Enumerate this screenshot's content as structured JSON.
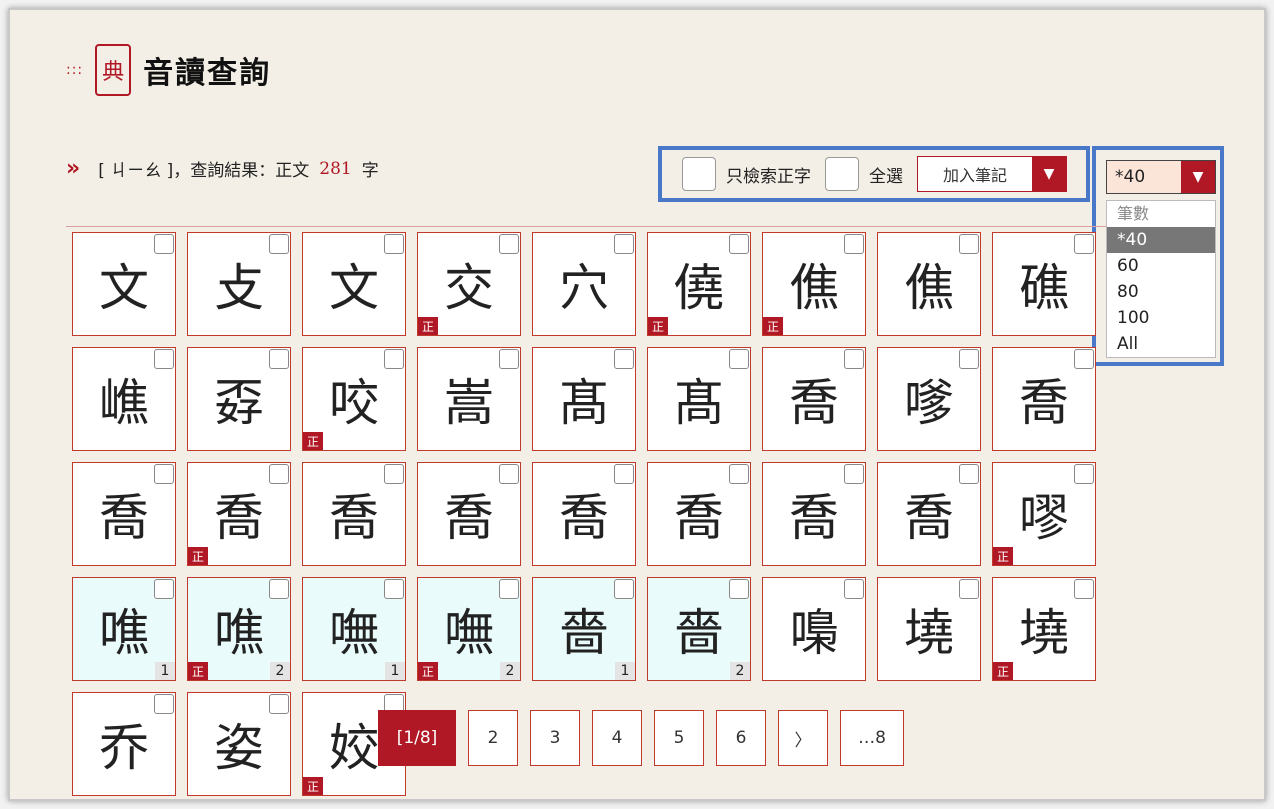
{
  "header": {
    "dots": ":::",
    "seal": "典",
    "title": "音讀查詢"
  },
  "result": {
    "query": "[ ㄐㄧㄠ ]，查詢結果：正文",
    "count": "281",
    "unit": "字"
  },
  "toolbar": {
    "only_label": "只檢索正字",
    "all_label": "全選",
    "add_note": "加入筆記"
  },
  "page_size": {
    "current": "*40",
    "options_header": "筆數",
    "options": [
      "*40",
      "60",
      "80",
      "100",
      "All"
    ]
  },
  "cells": [
    {
      "ch": "文"
    },
    {
      "ch": "攴"
    },
    {
      "ch": "文"
    },
    {
      "ch": "交",
      "zh": "正"
    },
    {
      "ch": "穴"
    },
    {
      "ch": "僥",
      "zh": "正"
    },
    {
      "ch": "僬",
      "zh": "正"
    },
    {
      "ch": "僬"
    },
    {
      "ch": "礁"
    },
    {
      "ch": "嶕"
    },
    {
      "ch": "孬"
    },
    {
      "ch": "咬",
      "zh": "正"
    },
    {
      "ch": "嵩"
    },
    {
      "ch": "髙"
    },
    {
      "ch": "髙"
    },
    {
      "ch": "喬"
    },
    {
      "ch": "嗲"
    },
    {
      "ch": "喬"
    },
    {
      "ch": "喬"
    },
    {
      "ch": "喬",
      "zh": "正"
    },
    {
      "ch": "喬"
    },
    {
      "ch": "喬"
    },
    {
      "ch": "喬"
    },
    {
      "ch": "喬"
    },
    {
      "ch": "喬"
    },
    {
      "ch": "喬"
    },
    {
      "ch": "嘐",
      "zh": "正"
    },
    {
      "ch": "噍",
      "num": "1",
      "alt": true
    },
    {
      "ch": "噍",
      "zh": "正",
      "num": "2",
      "alt": true
    },
    {
      "ch": "嘸",
      "num": "1",
      "alt": true
    },
    {
      "ch": "嘸",
      "zh": "正",
      "num": "2",
      "alt": true
    },
    {
      "ch": "嗇",
      "num": "1",
      "alt": true
    },
    {
      "ch": "嗇",
      "num": "2",
      "alt": true
    },
    {
      "ch": "嘄"
    },
    {
      "ch": "墝"
    },
    {
      "ch": "墝",
      "zh": "正"
    },
    {
      "ch": "乔"
    },
    {
      "ch": "姿"
    },
    {
      "ch": "姣",
      "zh": "正"
    }
  ],
  "pager": [
    "[1/8]",
    "2",
    "3",
    "4",
    "5",
    "6",
    "〉",
    "…8"
  ]
}
